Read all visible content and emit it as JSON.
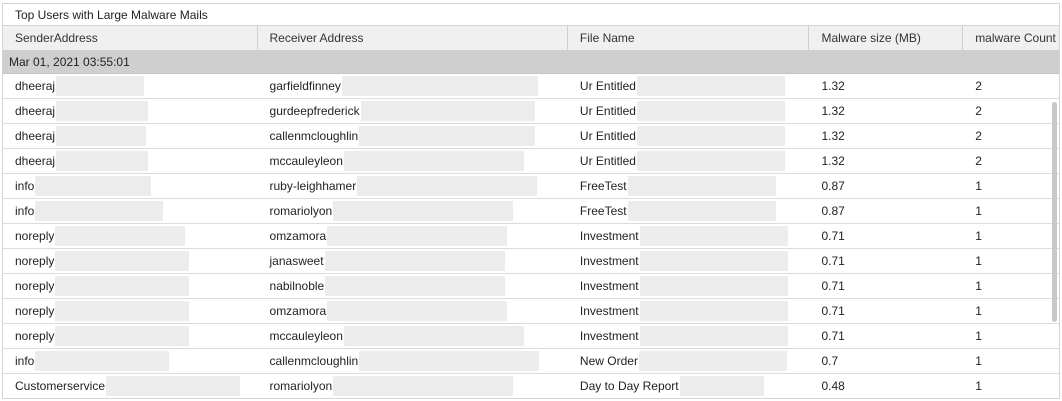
{
  "panel": {
    "title": "Top Users with Large Malware Mails"
  },
  "columns": [
    "SenderAddress",
    "Receiver Address",
    "File Name",
    "Malware size (MB)",
    "malware Count"
  ],
  "group": {
    "label": "Mar 01, 2021 03:55:01"
  },
  "rows": [
    {
      "sender": "dheeraj",
      "receiver": "garfieldfinney",
      "file": "Ur Entitled",
      "size": "1.32",
      "count": "2"
    },
    {
      "sender": "dheeraj",
      "receiver": "gurdeepfrederick",
      "file": "Ur Entitled",
      "size": "1.32",
      "count": "2"
    },
    {
      "sender": "dheeraj",
      "receiver": "callenmcloughlin",
      "file": "Ur Entitled",
      "size": "1.32",
      "count": "2"
    },
    {
      "sender": "dheeraj",
      "receiver": "mccauleyleon",
      "file": "Ur Entitled",
      "size": "1.32",
      "count": "2"
    },
    {
      "sender": "info",
      "receiver": "ruby-leighhamer",
      "file": "FreeTest",
      "size": "0.87",
      "count": "1"
    },
    {
      "sender": "info",
      "receiver": "romariolyon",
      "file": "FreeTest",
      "size": "0.87",
      "count": "1"
    },
    {
      "sender": "noreply",
      "receiver": "omzamora",
      "file": "Investment",
      "size": "0.71",
      "count": "1"
    },
    {
      "sender": "noreply",
      "receiver": "janasweet",
      "file": "Investment",
      "size": "0.71",
      "count": "1"
    },
    {
      "sender": "noreply",
      "receiver": "nabilnoble",
      "file": "Investment",
      "size": "0.71",
      "count": "1"
    },
    {
      "sender": "noreply",
      "receiver": "omzamora",
      "file": "Investment",
      "size": "0.71",
      "count": "1"
    },
    {
      "sender": "noreply",
      "receiver": "mccauleyleon",
      "file": "Investment",
      "size": "0.71",
      "count": "1"
    },
    {
      "sender": "info",
      "receiver": "callenmcloughlin",
      "file": "New Order",
      "size": "0.7",
      "count": "1"
    },
    {
      "sender": "Customerservice",
      "receiver": "romariolyon",
      "file": "Day to Day Report",
      "size": "0.48",
      "count": "1"
    }
  ]
}
